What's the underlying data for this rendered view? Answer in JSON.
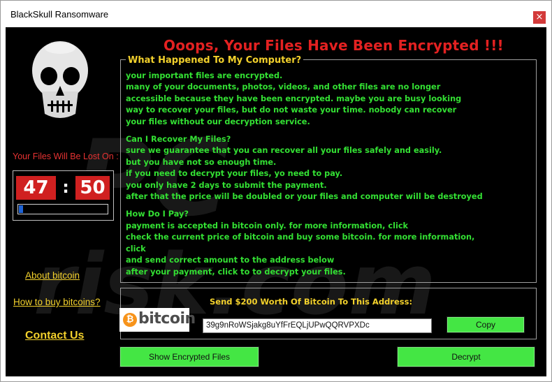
{
  "window": {
    "title": "BlackSkull Ransomware",
    "close_glyph": "×"
  },
  "headline": "Ooops, Your Files Have Been Encrypted !!!",
  "countdown": {
    "label": "Your Files Will Be Lost On :",
    "hours": "47",
    "separator": ":",
    "minutes": "50",
    "progress_fraction": 0.05
  },
  "links": {
    "about_bitcoin": "About bitcoin",
    "how_to_buy": "How to buy bitcoins?",
    "contact_us": "Contact Us"
  },
  "info": {
    "legend": "What Happened To My Computer?",
    "section1": [
      "your important files are encrypted.",
      "many of your documents, photos, videos, and other files are no longer",
      "accessible because they have been encrypted. maybe you are busy looking",
      "way to recover your files, but do not waste your time. nobody can recover",
      "your files without our decryption service."
    ],
    "section2_title": "Can I Recover My Files?",
    "section2": [
      "sure we guarantee that you can recover all your files safely and easily.",
      "but you have not so enough time.",
      "if you need to decrypt your files, yo need to pay.",
      "you only have 2 days to submit the payment.",
      "after that the price will be doubled or your files and computer will be destroyed"
    ],
    "section3_title": "How Do I Pay?",
    "section3": [
      "payment is accepted in bitcoin only. for more information, click",
      "check the current price of bitcoin and buy some bitcoin. for more information,",
      "click",
      "and send correct amount to the address below",
      "after your payment, click to to decrypt your files."
    ]
  },
  "payment": {
    "title": "Send $200 Worth Of Bitcoin To This Address:",
    "logo_text": "bitcoin",
    "logo_symbol": "₿",
    "address": "39g9nRoWSjakg8uYfFrEQLjUPwQQRVPXDc",
    "copy_label": "Copy"
  },
  "buttons": {
    "show_encrypted": "Show Encrypted Files",
    "decrypt": "Decrypt"
  },
  "colors": {
    "headline": "#e32121",
    "body_text": "#33e033",
    "link": "#f3d12c",
    "button": "#44e644",
    "timer_bg": "#d02020",
    "progress": "#1e63d6"
  },
  "icons": {
    "skull": "skull-icon",
    "close": "close-icon",
    "bitcoin": "bitcoin-logo"
  }
}
